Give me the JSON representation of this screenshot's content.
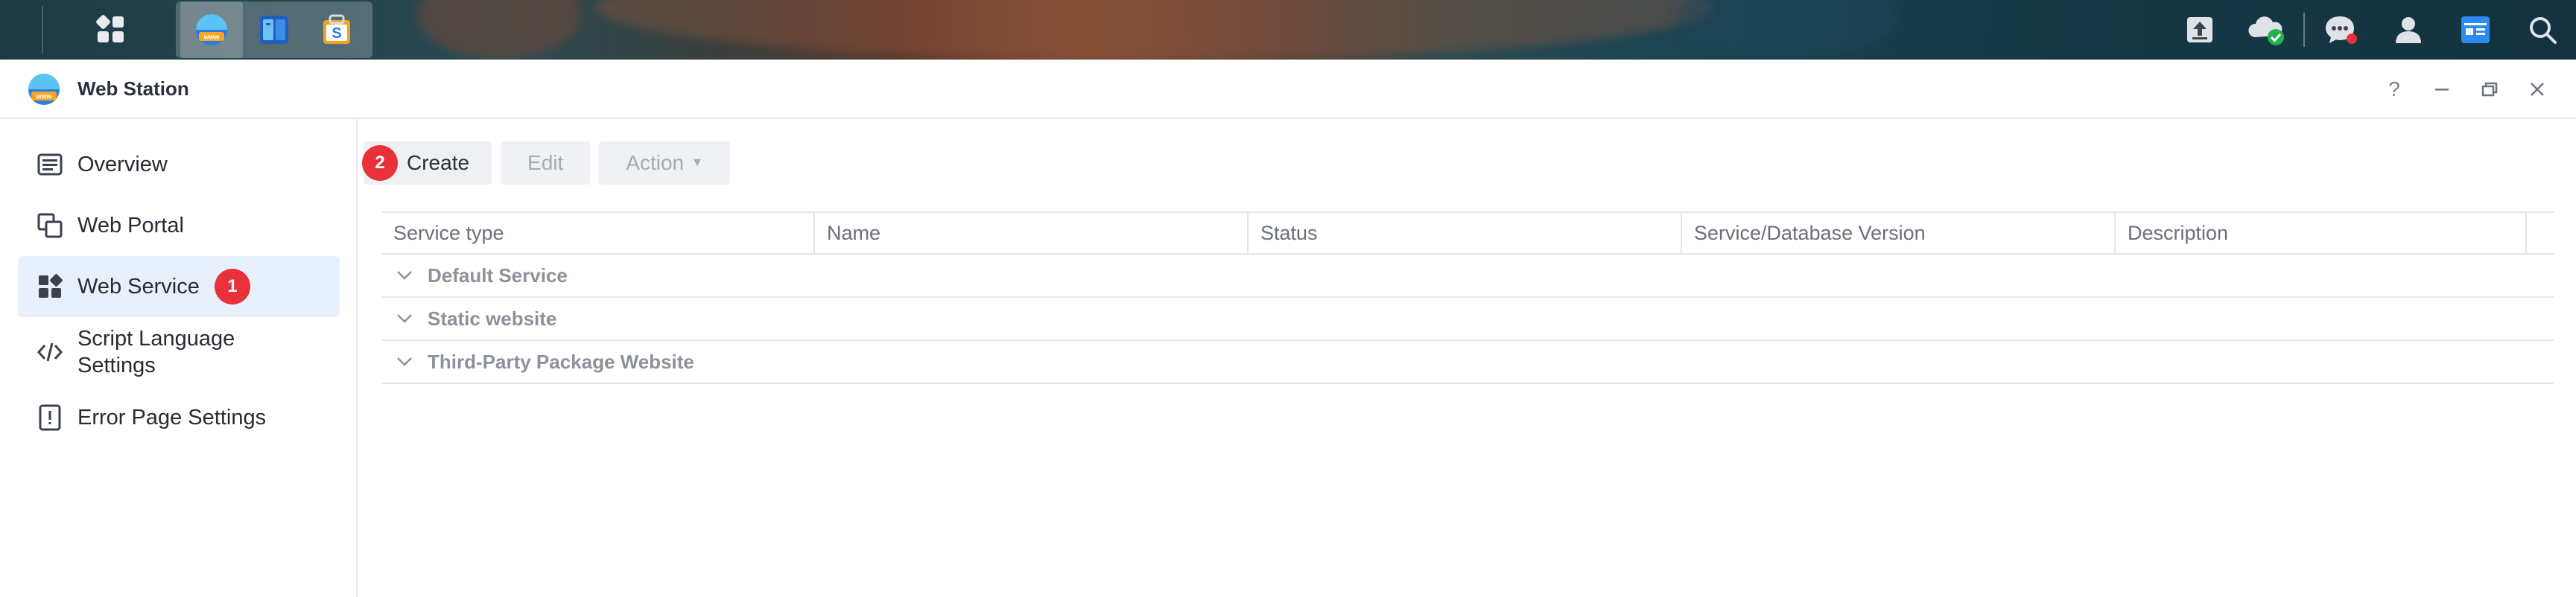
{
  "window": {
    "title": "Web Station",
    "controls": [
      "?",
      "–",
      "❐",
      "✕"
    ]
  },
  "sidebar": {
    "items": [
      {
        "label": "Overview",
        "icon": "overview-icon"
      },
      {
        "label": "Web Portal",
        "icon": "web-portal-icon"
      },
      {
        "label": "Web Service",
        "icon": "web-service-icon",
        "active": true,
        "badge": "1"
      },
      {
        "label": "Script Language Settings",
        "icon": "code-icon"
      },
      {
        "label": "Error Page Settings",
        "icon": "error-page-icon"
      }
    ]
  },
  "toolbar": {
    "create_label": "Create",
    "create_badge": "2",
    "edit_label": "Edit",
    "action_label": "Action"
  },
  "grid": {
    "columns": [
      "Service type",
      "Name",
      "Status",
      "Service/Database Version",
      "Description"
    ],
    "groups": [
      "Default Service",
      "Static website",
      "Third-Party Package Website"
    ]
  },
  "colors": {
    "accent": "#e8f0fb",
    "badge": "#e8313a"
  }
}
